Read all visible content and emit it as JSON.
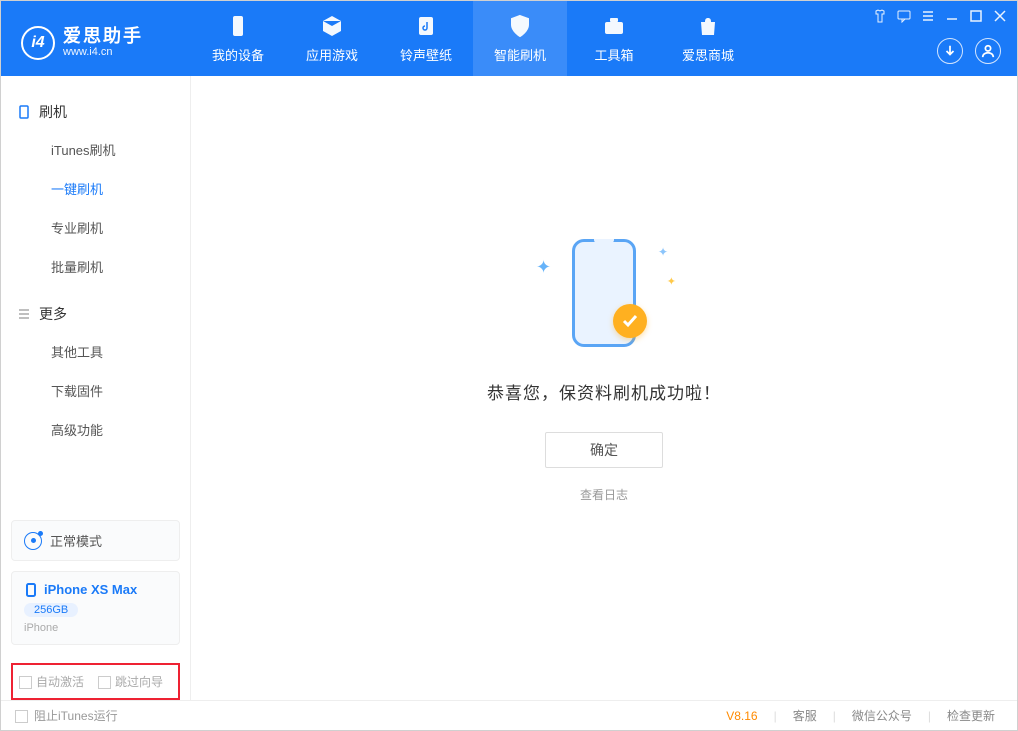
{
  "app": {
    "title": "爱思助手",
    "url": "www.i4.cn"
  },
  "tabs": {
    "device": "我的设备",
    "apps": "应用游戏",
    "ringtone": "铃声壁纸",
    "flash": "智能刷机",
    "toolbox": "工具箱",
    "store": "爱思商城"
  },
  "sidebar": {
    "group1": "刷机",
    "itunes": "iTunes刷机",
    "oneclick": "一键刷机",
    "pro": "专业刷机",
    "batch": "批量刷机",
    "group2": "更多",
    "other": "其他工具",
    "firmware": "下载固件",
    "advanced": "高级功能"
  },
  "mode": {
    "label": "正常模式"
  },
  "device": {
    "name": "iPhone XS Max",
    "storage": "256GB",
    "type": "iPhone"
  },
  "checkboxes": {
    "auto_activate": "自动激活",
    "skip_wizard": "跳过向导"
  },
  "main": {
    "success": "恭喜您，保资料刷机成功啦！",
    "ok": "确定",
    "log": "查看日志"
  },
  "footer": {
    "block_itunes": "阻止iTunes运行",
    "version": "V8.16",
    "support": "客服",
    "wechat": "微信公众号",
    "update": "检查更新"
  }
}
